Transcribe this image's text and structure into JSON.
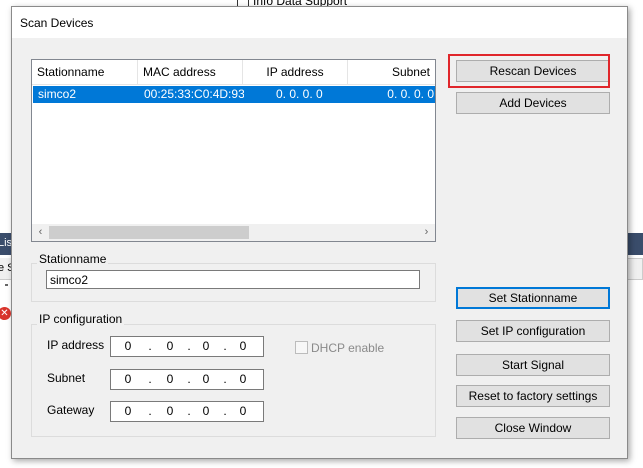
{
  "background": {
    "top_checkbox_label": "Info Data Support",
    "left_strip_text": "Lis",
    "left_row_text": "e S",
    "error_icon": "error-icon"
  },
  "dialog": {
    "title": "Scan Devices",
    "device_list": {
      "columns": [
        "Stationname",
        "MAC address",
        "IP address",
        "Subnet"
      ],
      "rows": [
        {
          "stationname": "simco2",
          "mac": "00:25:33:C0:4D:93",
          "ip": "0. 0. 0. 0",
          "subnet": "0. 0. 0. 0",
          "selected": true
        }
      ]
    },
    "stationname_group": {
      "label": "Stationname",
      "value": "simco2"
    },
    "ip_config_group": {
      "label": "IP configuration",
      "ip_address": {
        "label": "IP address",
        "octets": [
          "0",
          "0",
          "0",
          "0"
        ]
      },
      "subnet": {
        "label": "Subnet",
        "octets": [
          "0",
          "0",
          "0",
          "0"
        ]
      },
      "gateway": {
        "label": "Gateway",
        "octets": [
          "0",
          "0",
          "0",
          "0"
        ]
      },
      "dhcp": {
        "label": "DHCP enable",
        "checked": false,
        "enabled": false
      }
    },
    "buttons": {
      "rescan": "Rescan Devices",
      "add": "Add Devices",
      "set_stationname": "Set Stationname",
      "set_ip": "Set IP configuration",
      "start_signal": "Start Signal",
      "reset_factory": "Reset to factory settings",
      "close": "Close Window"
    },
    "colors": {
      "selection": "#0078d7",
      "highlight_box": "#e0262b",
      "focus_border": "#0078d7"
    }
  }
}
